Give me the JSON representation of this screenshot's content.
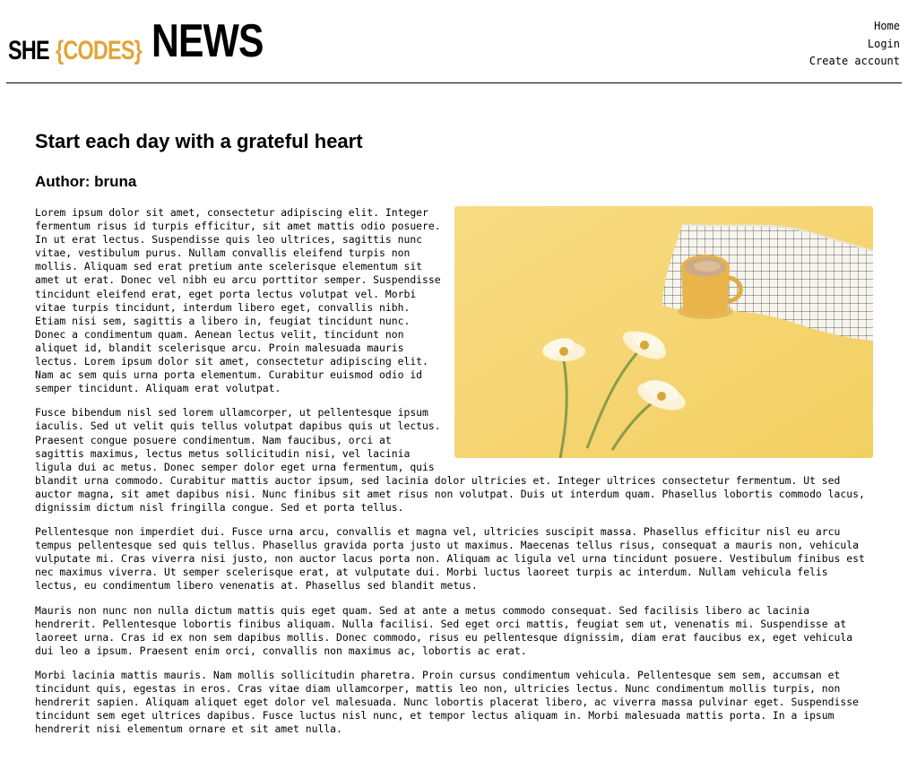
{
  "header": {
    "logo": {
      "she": "SHE",
      "codes": "{CODES}",
      "news": "NEWS"
    },
    "nav": {
      "home": "Home",
      "login": "Login",
      "create_account": "Create account"
    }
  },
  "article": {
    "title": "Start each day with a grateful heart",
    "author": "Author: bruna",
    "image": {
      "subject": "coffee mug, checkered napkin and three daisies on a yellow background"
    },
    "paragraphs": [
      "Lorem ipsum dolor sit amet, consectetur adipiscing elit. Integer fermentum risus id turpis efficitur, sit amet mattis odio posuere. In ut erat lectus. Suspendisse quis leo ultrices, sagittis nunc vitae, vestibulum purus. Nullam convallis eleifend turpis non mollis. Aliquam sed erat pretium ante scelerisque elementum sit amet ut erat. Donec vel nibh eu arcu porttitor semper. Suspendisse tincidunt eleifend erat, eget porta lectus volutpat vel. Morbi vitae turpis tincidunt, interdum libero eget, convallis nibh. Etiam nisi sem, sagittis a libero in, feugiat tincidunt nunc. Donec a condimentum quam. Aenean lectus velit, tincidunt non aliquet id, blandit scelerisque arcu. Proin malesuada mauris lectus. Lorem ipsum dolor sit amet, consectetur adipiscing elit. Nam ac sem quis urna porta elementum. Curabitur euismod odio id semper tincidunt. Aliquam erat volutpat.",
      "Fusce bibendum nisl sed lorem ullamcorper, ut pellentesque ipsum iaculis. Sed ut velit quis tellus volutpat dapibus quis ut lectus. Praesent congue posuere condimentum. Nam faucibus, orci at sagittis maximus, lectus metus sollicitudin nisi, vel lacinia ligula dui ac metus. Donec semper dolor eget urna fermentum, quis blandit urna commodo. Curabitur mattis auctor ipsum, sed lacinia dolor ultricies et. Integer ultrices consectetur fermentum. Ut sed auctor magna, sit amet dapibus nisi. Nunc finibus sit amet risus non volutpat. Duis ut interdum quam. Phasellus lobortis commodo lacus, dignissim dictum nisl fringilla congue. Sed et porta tellus.",
      "Pellentesque non imperdiet dui. Fusce urna arcu, convallis et magna vel, ultricies suscipit massa. Phasellus efficitur nisl eu arcu tempus pellentesque sed quis tellus. Phasellus gravida porta justo ut maximus. Maecenas tellus risus, consequat a mauris non, vehicula vulputate mi. Cras viverra nisi justo, non auctor lacus porta non. Aliquam ac ligula vel urna tincidunt posuere. Vestibulum finibus est nec maximus viverra. Ut semper scelerisque erat, at vulputate dui. Morbi luctus laoreet turpis ac interdum. Nullam vehicula felis lectus, eu condimentum libero venenatis at. Phasellus sed blandit metus.",
      "Mauris non nunc non nulla dictum mattis quis eget quam. Sed at ante a metus commodo consequat. Sed facilisis libero ac lacinia hendrerit. Pellentesque lobortis finibus aliquam. Nulla facilisi. Sed eget orci mattis, feugiat sem ut, venenatis mi. Suspendisse at laoreet urna. Cras id ex non sem dapibus mollis. Donec commodo, risus eu pellentesque dignissim, diam erat faucibus ex, eget vehicula dui leo a ipsum. Praesent enim orci, convallis non maximus ac, lobortis ac erat.",
      "Morbi lacinia mattis mauris. Nam mollis sollicitudin pharetra. Proin cursus condimentum vehicula. Pellentesque sem sem, accumsan et tincidunt quis, egestas in eros. Cras vitae diam ullamcorper, mattis leo non, ultricies lectus. Nunc condimentum mollis turpis, non hendrerit sapien. Aliquam aliquet eget dolor vel malesuada. Nunc lobortis placerat libero, ac viverra massa pulvinar eget. Suspendisse tincidunt sem eget ultrices dapibus. Fusce luctus nisl nunc, et tempor lectus aliquam in. Morbi malesuada mattis porta. In a ipsum hendrerit nisi elementum ornare et sit amet nulla."
    ]
  },
  "colors": {
    "accent": "#e3a43a",
    "image_background": "#f6d776",
    "text": "#000000"
  }
}
